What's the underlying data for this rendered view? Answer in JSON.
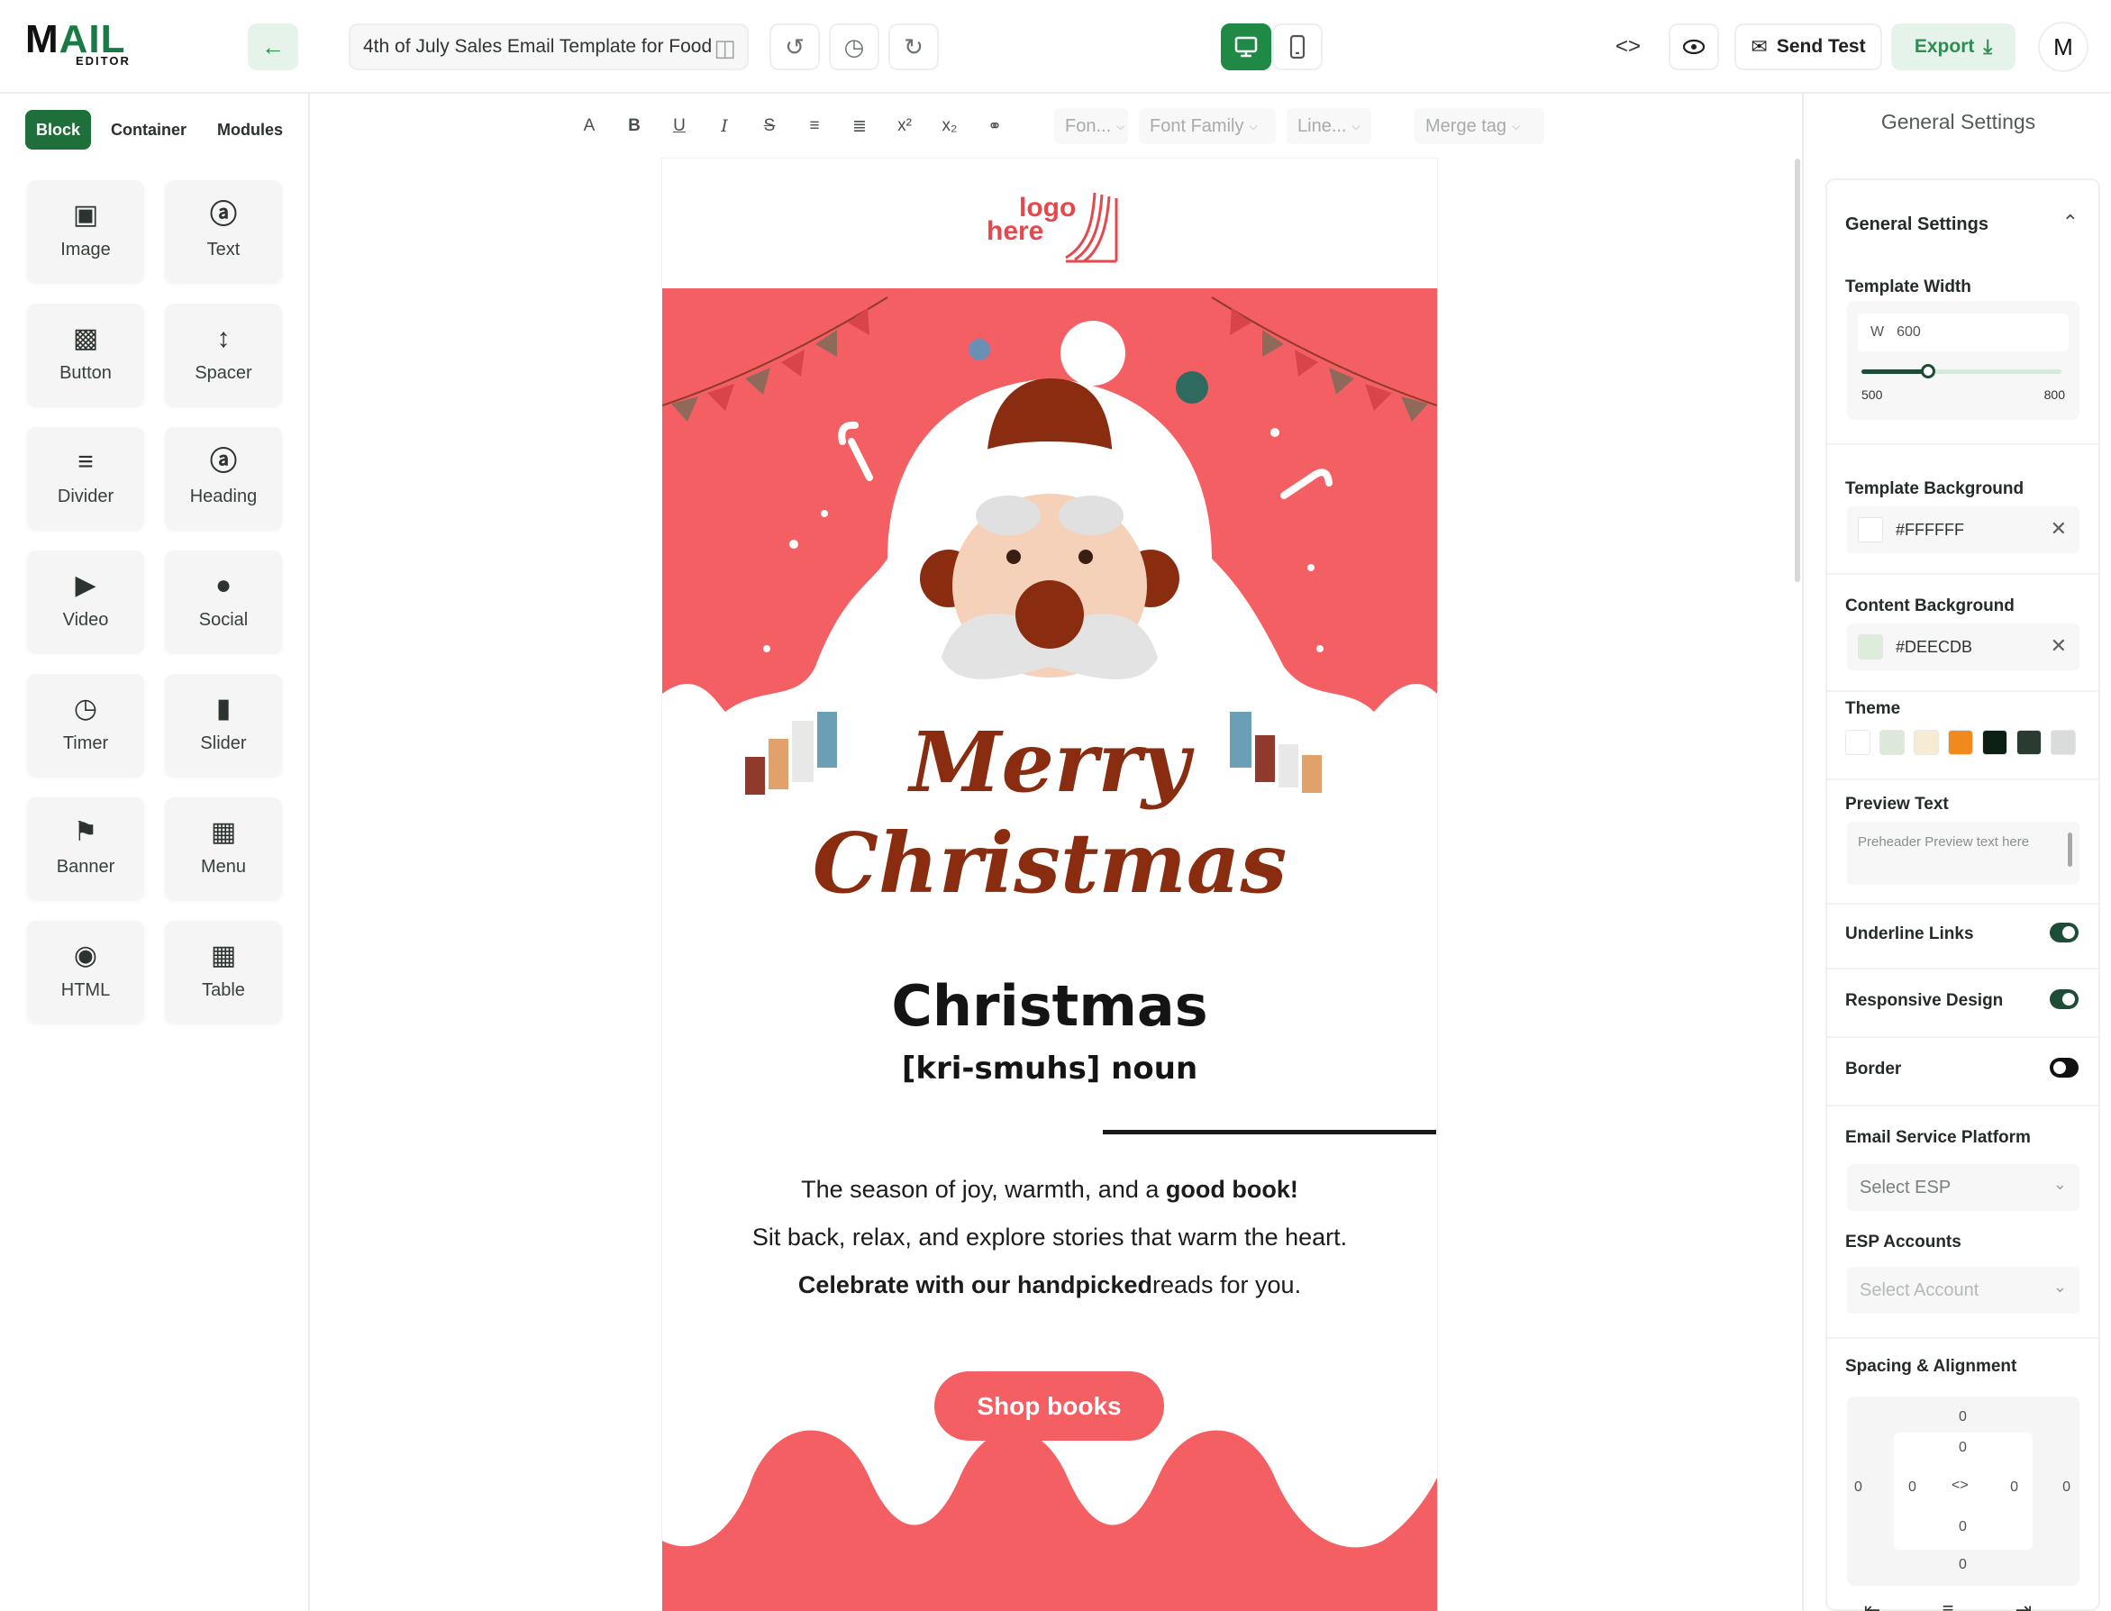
{
  "app": {
    "logo_word_a": "M",
    "logo_word_b": "AIL",
    "logo_sub": "EDITOR",
    "template_title": "4th of July Sales Email Template for Food",
    "send_test_label": "Send Test",
    "export_label": "Export",
    "avatar_initial": "M",
    "accent": "#1f8a45"
  },
  "left": {
    "tabs": [
      {
        "label": "Block",
        "active": true
      },
      {
        "label": "Container",
        "active": false
      },
      {
        "label": "Modules",
        "active": false
      }
    ],
    "blocks": [
      {
        "label": "Image",
        "icon": "image-icon"
      },
      {
        "label": "Text",
        "icon": "text-icon"
      },
      {
        "label": "Button",
        "icon": "button-icon"
      },
      {
        "label": "Spacer",
        "icon": "spacer-icon"
      },
      {
        "label": "Divider",
        "icon": "divider-icon"
      },
      {
        "label": "Heading",
        "icon": "heading-icon"
      },
      {
        "label": "Video",
        "icon": "video-icon"
      },
      {
        "label": "Social",
        "icon": "social-icon"
      },
      {
        "label": "Timer",
        "icon": "timer-icon"
      },
      {
        "label": "Slider",
        "icon": "slider-icon"
      },
      {
        "label": "Banner",
        "icon": "banner-icon"
      },
      {
        "label": "Menu",
        "icon": "menu-icon"
      },
      {
        "label": "HTML",
        "icon": "html-icon"
      },
      {
        "label": "Table",
        "icon": "table-icon"
      }
    ]
  },
  "toolbar": {
    "font_size_placeholder": "Fon...",
    "font_family_placeholder": "Font Family",
    "line_height_placeholder": "Line...",
    "merge_tag_placeholder": "Merge tag"
  },
  "email": {
    "logo_line1": "logo",
    "logo_line2": "here",
    "merry_line1": "Merry",
    "merry_line2": "Christmas",
    "title": "Christmas",
    "phonetic": "[kri-smuhs] noun",
    "body_plain_1": "The season of joy, warmth, and a ",
    "body_bold_1": "good book!",
    "body_plain_2": "Sit back, relax, and explore stories that warm the heart. ",
    "body_bold_2": "Celebrate with our handpicked",
    "body_plain_3": "reads for you.",
    "cta_label": "Shop books",
    "hero_color": "#f35f62",
    "brown": "#8a2c0f"
  },
  "settings": {
    "panel_title": "General Settings",
    "section_title": "General Settings",
    "template_width_label": "Template Width",
    "width_prefix": "W",
    "width_value": "600",
    "width_min": "500",
    "width_max": "800",
    "width_fraction": 0.333,
    "template_bg_label": "Template Background",
    "template_bg_value": "#FFFFFF",
    "content_bg_label": "Content Background",
    "content_bg_value": "#DEECDB",
    "theme_label": "Theme",
    "theme_colors": [
      "#ffffff",
      "#dde8db",
      "#f6ecd3",
      "#f08a1c",
      "#0c1f15",
      "#2a3c31",
      "#d9dcda"
    ],
    "preview_label": "Preview Text",
    "preview_placeholder": "Preheader Preview text here",
    "underline_label": "Underline Links",
    "underline_on": true,
    "responsive_label": "Responsive Design",
    "responsive_on": true,
    "border_label": "Border",
    "border_on": false,
    "esp_label": "Email Service Platform",
    "esp_placeholder": "Select ESP",
    "esp_accounts_label": "ESP Accounts",
    "esp_accounts_placeholder": "Select Account",
    "spacing_label": "Spacing & Alignment",
    "spacing": {
      "margin_top": "0",
      "margin_right": "0",
      "margin_bottom": "0",
      "margin_left": "0",
      "padding_top": "0",
      "padding_right": "0",
      "padding_bottom": "0",
      "padding_left": "0"
    }
  }
}
